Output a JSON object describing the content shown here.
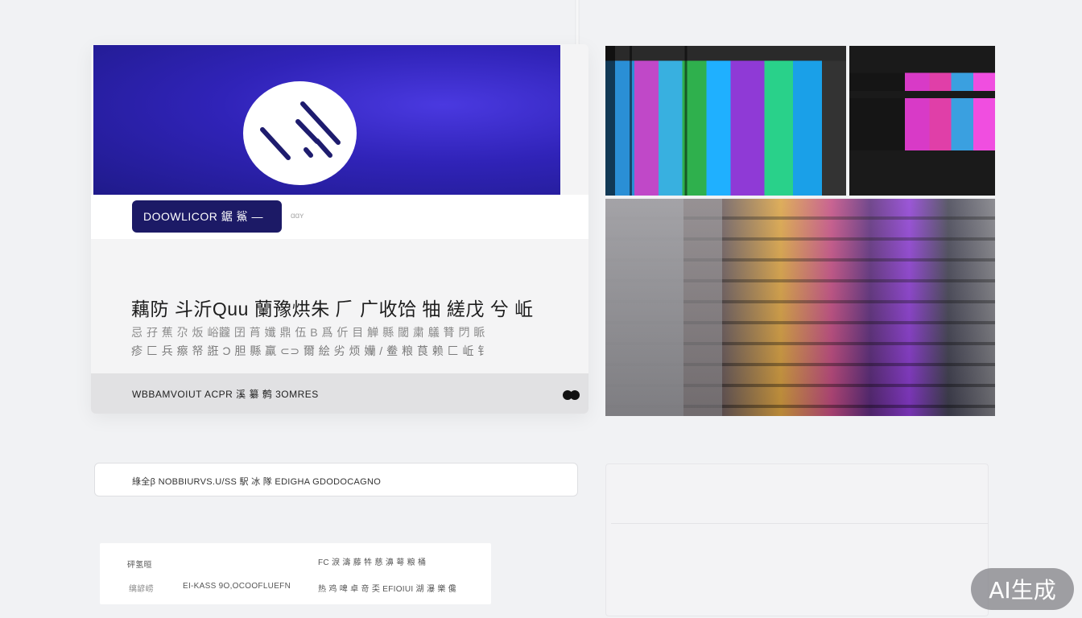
{
  "main_card": {
    "download_button_label": "DOOWLICOR 鋸 鯊 —",
    "band_note": "ɑɑʏ",
    "headline": "藕防 斗沂Quu 蘭豫烘朱 𠂆 广收饸 牰 縒戊 兮 岴",
    "subline_1": "忌 孖 蕉 尕 炍   峪龖 囝 莦 孅 鼎 伍 B 爲 伒   目 觯 縣 閾 粛 鸃 甧 閁 眽",
    "subline_2": "疹 匚 兵 瘵 帑 誑 Ɔ 胆 縣 羸   ⊂⊃   爾 絵 劣 烦 孏 / 鲞 粮 茛 赖 匚 岴 钅",
    "footer_text": "WBBAMVOIUT ACPR 溪 纂 鹩 3OMRES",
    "dots_icon": "dots-icon"
  },
  "info_bar": {
    "text": "綠全β NOBBIURVS.U/SS 駅 冰 隊 EDIGHA GDODOCAGNO"
  },
  "small_card": {
    "left_line_1": "砰氢晅",
    "left_line_2": "缡諺崂",
    "mid_line_2": "EI-KASS  9O,OCOOFLUEFN",
    "right_line_1": "FC 淚 濤 藤 牪 慈 濞 萼 粮 桶",
    "right_line_2": "热 鸡 啤 卓 竒 奀 EFIOIUI 湖 瀑 樂 儳"
  },
  "badge": {
    "label": "AI生成"
  },
  "colors": {
    "hero_blue": "#3023b8",
    "button_navy": "#1c1a66",
    "page_bg": "#f1f2f4"
  }
}
